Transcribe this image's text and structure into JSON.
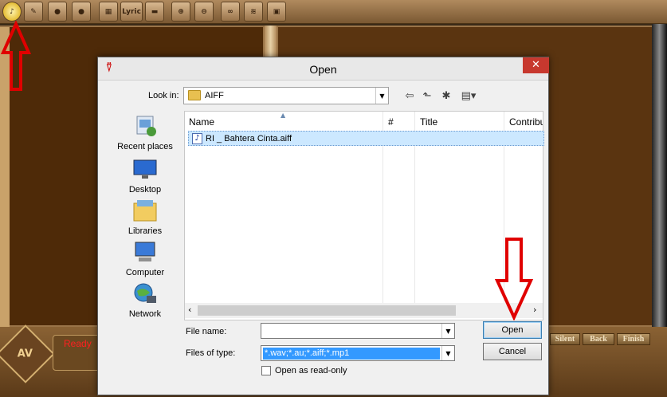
{
  "app": {
    "toolbar_buttons": [
      {
        "icon": "open-file-icon"
      },
      {
        "icon": "edit-icon"
      },
      {
        "icon": "record-icon"
      },
      {
        "icon": "record-edit-icon"
      },
      {
        "icon": "grid-icon"
      },
      {
        "label": "Lyric"
      },
      {
        "icon": "film-icon"
      },
      {
        "icon": "zoom-in-icon"
      },
      {
        "icon": "zoom-out-icon"
      },
      {
        "icon": "link-icon"
      },
      {
        "icon": "waveform-icon"
      },
      {
        "icon": "lock-icon"
      }
    ],
    "status": "Ready",
    "logo_text": "AV",
    "controls": {
      "silent": "Silent",
      "back": "Back",
      "finish": "Finish"
    },
    "annotation_color": "#e00000"
  },
  "dialog": {
    "title": "Open",
    "look_in_label": "Look in:",
    "look_in_value": "AIFF",
    "places": [
      "Recent places",
      "Desktop",
      "Libraries",
      "Computer",
      "Network"
    ],
    "columns": [
      "Name",
      "#",
      "Title",
      "Contribu"
    ],
    "files": [
      {
        "name": "RI _ Bahtera Cinta.aiff",
        "icon": "audio-file-icon",
        "selected": true
      }
    ],
    "file_name_label": "File name:",
    "file_name_value": "",
    "files_of_type_label": "Files of type:",
    "files_of_type_value": "*.wav;*.au;*.aiff;*.mp1",
    "read_only_label": "Open as read-only",
    "open_button": "Open",
    "cancel_button": "Cancel"
  }
}
